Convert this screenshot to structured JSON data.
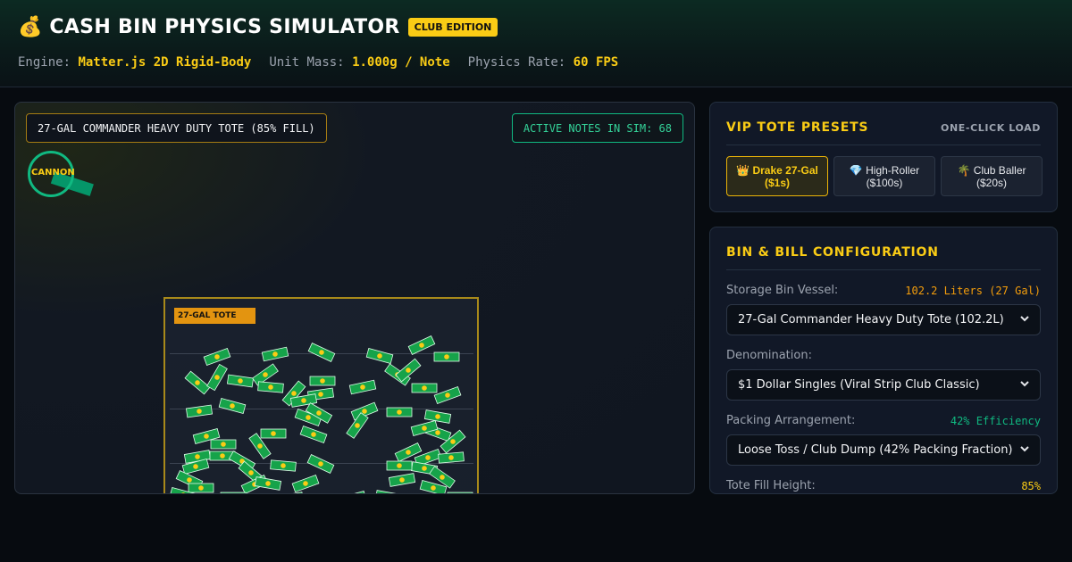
{
  "header": {
    "icon": "money-bag-icon",
    "icon_glyph": "💰",
    "title": "CASH BIN PHYSICS SIMULATOR",
    "badge": "CLUB EDITION",
    "stats": [
      {
        "label": "Engine:",
        "value": "Matter.js 2D Rigid-Body"
      },
      {
        "label": "Unit Mass:",
        "value": "1.000g / Note"
      },
      {
        "label": "Physics Rate:",
        "value": "60 FPS"
      }
    ]
  },
  "simulation": {
    "bin_label": "27-GAL COMMANDER HEAVY DUTY TOTE (85% FILL)",
    "active_notes": "ACTIVE NOTES IN SIM: 68",
    "cannon_label": "CANNON",
    "tote_tag": "27-GAL TOTE",
    "colors": {
      "note": "#16a34a",
      "note_dot": "#facc15",
      "tote_border": "#a8891a"
    }
  },
  "presets": {
    "title": "VIP TOTE PRESETS",
    "hint": "ONE-CLICK LOAD",
    "items": [
      {
        "icon": "crown-icon",
        "glyph": "👑",
        "line1": "Drake 27-Gal",
        "line2": "($1s)",
        "active": true
      },
      {
        "icon": "gem-icon",
        "glyph": "💎",
        "line1": "High-Roller",
        "line2": "($100s)",
        "active": false
      },
      {
        "icon": "palm-tree-icon",
        "glyph": "🌴",
        "line1": "Club Baller",
        "line2": "($20s)",
        "active": false
      }
    ]
  },
  "config": {
    "title": "BIN & BILL CONFIGURATION",
    "storage_label": "Storage Bin Vessel:",
    "storage_note": "102.2 Liters (27 Gal)",
    "storage_value": "27-Gal Commander Heavy Duty Tote (102.2L)",
    "denom_label": "Denomination:",
    "denom_value": "$1 Dollar Singles (Viral Strip Club Classic)",
    "packing_label": "Packing Arrangement:",
    "packing_note": "42% Efficiency",
    "packing_value": "Loose Toss / Club Dump (42% Packing Fraction)",
    "fill_label": "Tote Fill Height:",
    "fill_note": "85%"
  }
}
